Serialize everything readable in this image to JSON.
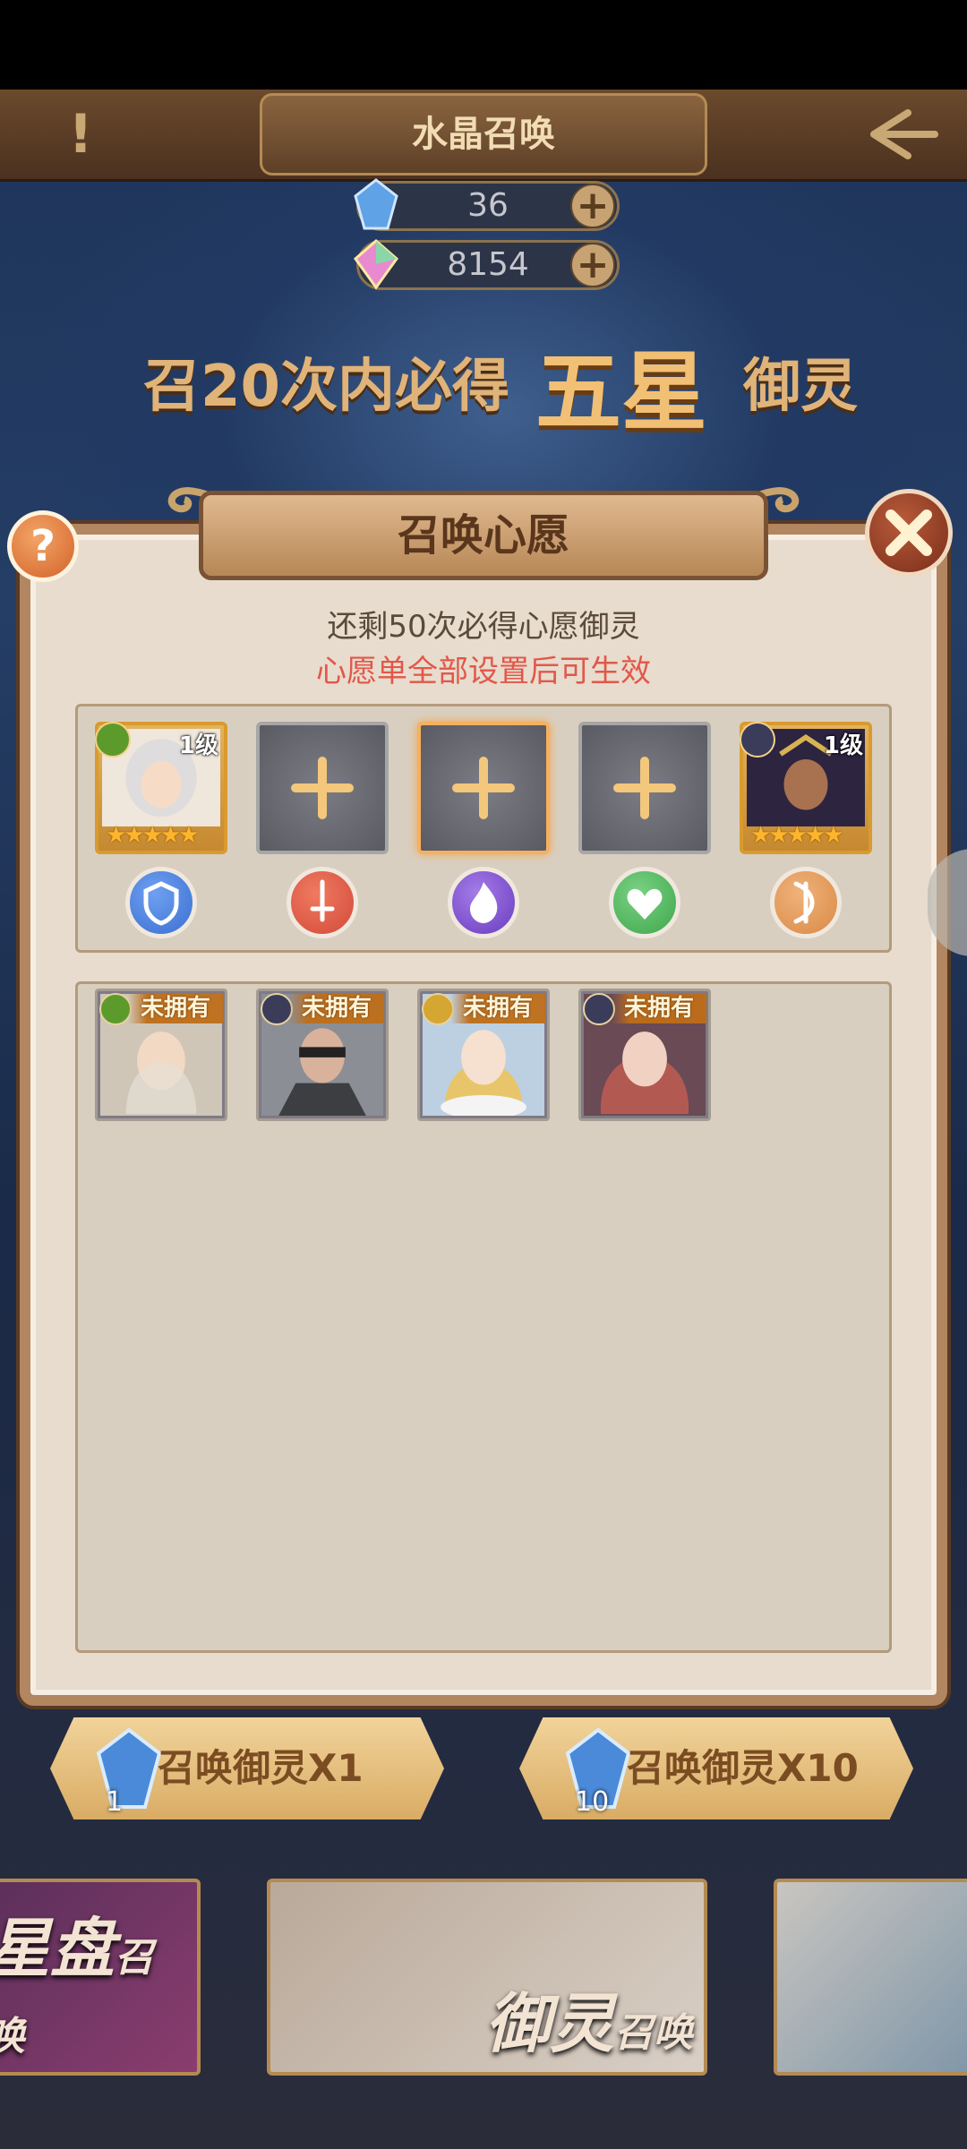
{
  "header": {
    "title": "水晶召唤"
  },
  "currencies": [
    {
      "icon": "blue-crystal-icon",
      "value": "36"
    },
    {
      "icon": "rainbow-gem-icon",
      "value": "8154"
    }
  ],
  "banner": {
    "pre": "召20次内必得",
    "highlight": "五星",
    "post": "御灵"
  },
  "dialog": {
    "title": "召唤心愿",
    "hint_remaining": "还剩50次必得心愿御灵",
    "hint_condition": "心愿单全部设置后可生效"
  },
  "wish_slots": [
    {
      "state": "filled",
      "level": "1级",
      "stars": "★★★★★",
      "faction": "leaf-faction-icon",
      "color": "#5d9a2c"
    },
    {
      "state": "empty"
    },
    {
      "state": "empty",
      "selected": true
    },
    {
      "state": "empty"
    },
    {
      "state": "filled",
      "level": "1级",
      "stars": "★★★★★",
      "faction": "star-faction-icon",
      "color": "#3b3c5a"
    }
  ],
  "class_icons": [
    {
      "name": "shield-class-icon",
      "color": "#3a6fd1"
    },
    {
      "name": "sword-class-icon",
      "color": "#d24a3a"
    },
    {
      "name": "flame-class-icon",
      "color": "#7a4cc8"
    },
    {
      "name": "heart-class-icon",
      "color": "#3fa64b"
    },
    {
      "name": "bow-class-icon",
      "color": "#d98a46"
    }
  ],
  "pool": [
    {
      "tag": "未拥有",
      "faction": "leaf-faction-icon",
      "faction_color": "#5d9a2c"
    },
    {
      "tag": "未拥有",
      "faction": "star-faction-icon",
      "faction_color": "#3b3c5a"
    },
    {
      "tag": "未拥有",
      "faction": "sun-faction-icon",
      "faction_color": "#d6a633"
    },
    {
      "tag": "未拥有",
      "faction": "star-faction-icon",
      "faction_color": "#3b3c5a"
    }
  ],
  "summon_buttons": [
    {
      "label": "召唤御灵X1",
      "cost": "1"
    },
    {
      "label": "召唤御灵X10",
      "cost": "10"
    }
  ],
  "cards": [
    {
      "label_main": "星盘",
      "label_sub": "召唤"
    },
    {
      "label_main": "御灵",
      "label_sub": "召唤"
    },
    {
      "label_main": "",
      "label_sub": ""
    }
  ]
}
